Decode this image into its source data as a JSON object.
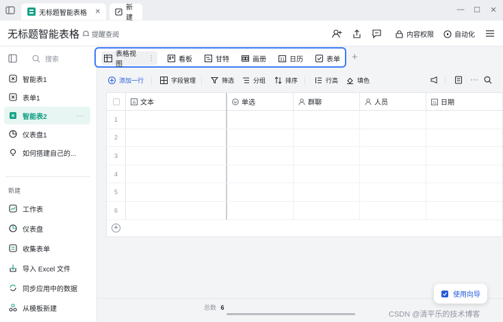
{
  "tabbar": {
    "tabs": [
      {
        "label": "无标题智能表格",
        "icon": "smart-table-icon",
        "closable": true
      },
      {
        "label": "新建",
        "icon": "new-doc-icon",
        "closable": false
      }
    ],
    "window_controls": [
      "minimize",
      "maximize",
      "close"
    ]
  },
  "header": {
    "title": "无标题智能表格",
    "remind_label": "提醒查阅",
    "content_permission_label": "内容权限",
    "automation_label": "自动化"
  },
  "sidebar": {
    "search_label": "搜索",
    "items": [
      {
        "label": "智能表1",
        "icon": "smart-table-icon",
        "active": false
      },
      {
        "label": "表单1",
        "icon": "form-icon",
        "active": false
      },
      {
        "label": "智能表2",
        "icon": "smart-table-icon",
        "active": true
      },
      {
        "label": "仪表盘1",
        "icon": "dashboard-icon",
        "active": false
      },
      {
        "label": "如何搭建自己的...",
        "icon": "bulb-icon",
        "active": false
      }
    ],
    "new_section_label": "新建",
    "new_items": [
      {
        "label": "工作表",
        "icon": "worksheet-icon"
      },
      {
        "label": "仪表盘",
        "icon": "dashboard-icon"
      },
      {
        "label": "收集表单",
        "icon": "collect-form-icon"
      },
      {
        "label": "导入 Excel 文件",
        "icon": "import-icon"
      },
      {
        "label": "同步应用中的数据",
        "icon": "sync-icon"
      },
      {
        "label": "从模板新建",
        "icon": "template-icon"
      }
    ]
  },
  "views": {
    "tabs": [
      {
        "label": "表格视图",
        "active": true
      },
      {
        "label": "看板",
        "active": false
      },
      {
        "label": "甘特",
        "active": false
      },
      {
        "label": "画册",
        "active": false
      },
      {
        "label": "日历",
        "active": false
      },
      {
        "label": "表单",
        "active": false
      }
    ],
    "add_label": "+"
  },
  "toolbar": {
    "add_row_label": "添加一行",
    "field_manage_label": "字段管理",
    "filter_label": "筛选",
    "group_label": "分组",
    "sort_label": "排序",
    "row_height_label": "行高",
    "fill_color_label": "填色",
    "more_label": "···"
  },
  "grid": {
    "columns": [
      {
        "label": "文本",
        "icon": "text-field-icon"
      },
      {
        "label": "单选",
        "icon": "single-select-icon"
      },
      {
        "label": "群聊",
        "icon": "group-chat-icon"
      },
      {
        "label": "人员",
        "icon": "person-icon"
      },
      {
        "label": "日期",
        "icon": "date-icon"
      }
    ],
    "rows": [
      "1",
      "2",
      "3",
      "4",
      "5",
      "6"
    ],
    "add_row_symbol": "+"
  },
  "footer": {
    "total_label": "总数",
    "total_value": "6"
  },
  "guide_label": "使用向导",
  "watermark": "CSDN @清平乐的技术博客",
  "colors": {
    "accent": "#14a085",
    "active_bg": "#e8f6f3",
    "highlight_border": "#3a7bf7",
    "link_blue": "#245bdb"
  }
}
